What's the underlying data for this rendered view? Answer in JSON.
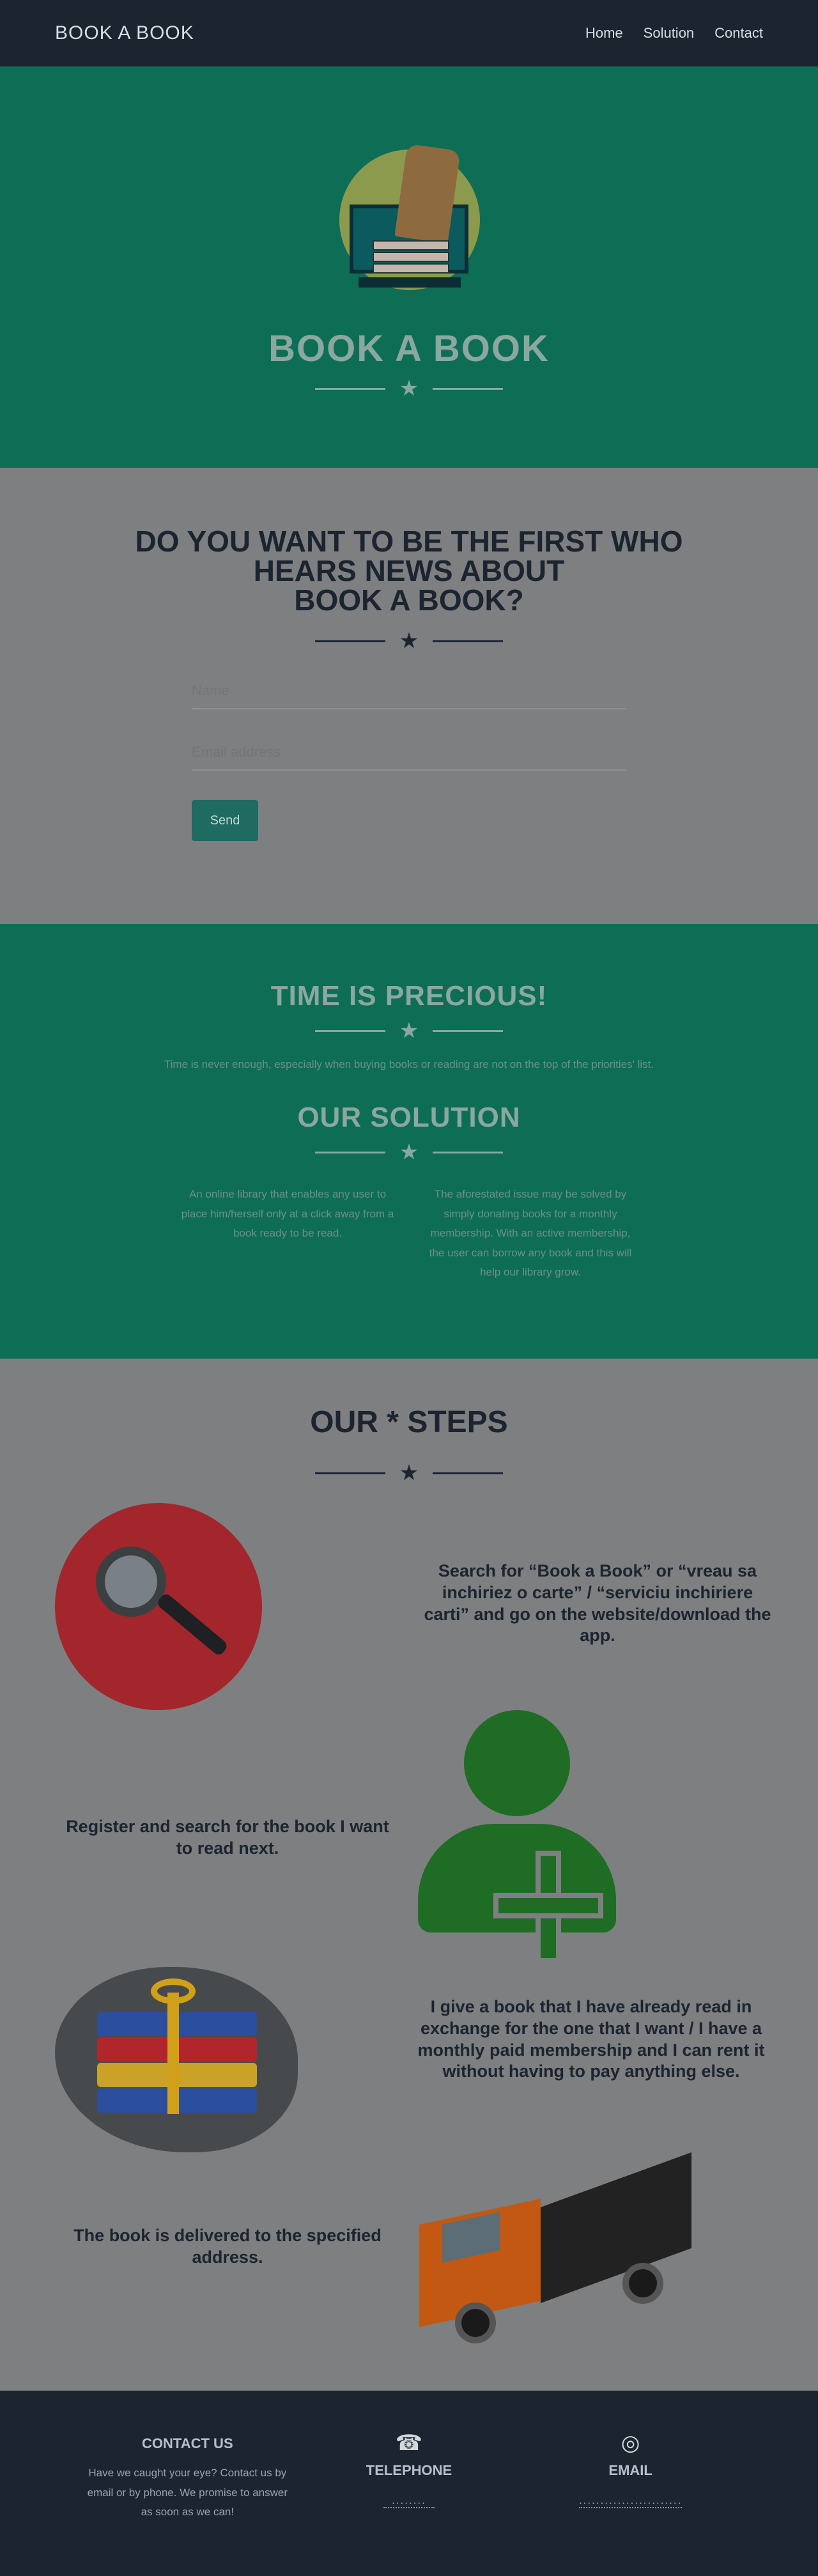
{
  "nav": {
    "brand": "BOOK A BOOK",
    "links": [
      "Home",
      "Solution",
      "Contact"
    ]
  },
  "hero": {
    "title": "BOOK A BOOK"
  },
  "subscribe": {
    "title_line1": "DO YOU WANT TO BE THE FIRST WHO",
    "title_line2": "HEARS NEWS ABOUT",
    "title_line3": "BOOK A BOOK?",
    "name_placeholder": "Name",
    "email_placeholder": "Email address",
    "send_label": "Send"
  },
  "precious": {
    "title": "TIME IS PRECIOUS!",
    "text": "Time is never enough, especially when buying books or reading are not on the top of the priorities' list.",
    "solution_title": "OUR SOLUTION",
    "col1": "An online library that enables any user to place him/herself only at a click away from a book ready to be read.",
    "col2": "The aforestated issue may be solved by simply donating books for a monthly membership. With an active membership, the user can borrow any book and this will help our library grow."
  },
  "steps": {
    "title": "OUR * STEPS",
    "step1": "Search for “Book a Book” or “vreau sa inchiriez o carte” / “serviciu inchiriere carti” and go on the website/download the app.",
    "step2": "Register and search for the book I want to read next.",
    "step3": "I give a book that I have already read in exchange for the one that I want / I have a monthly paid membership and I can rent it without having to pay anything else.",
    "step4": "The book is delivered to the specified address."
  },
  "footer": {
    "contact_title": "CONTACT US",
    "contact_text": "Have we caught your eye? Contact us by email or by phone. We promise to answer as soon as we can!",
    "phone_title": "TELEPHONE",
    "phone_value": "........",
    "email_title": "EMAIL",
    "email_value": "........................"
  },
  "colors": {
    "nav_bg": "#1c2430",
    "green": "#0e6e55",
    "gray": "#7d7f80",
    "accent": "#1f6a61"
  }
}
